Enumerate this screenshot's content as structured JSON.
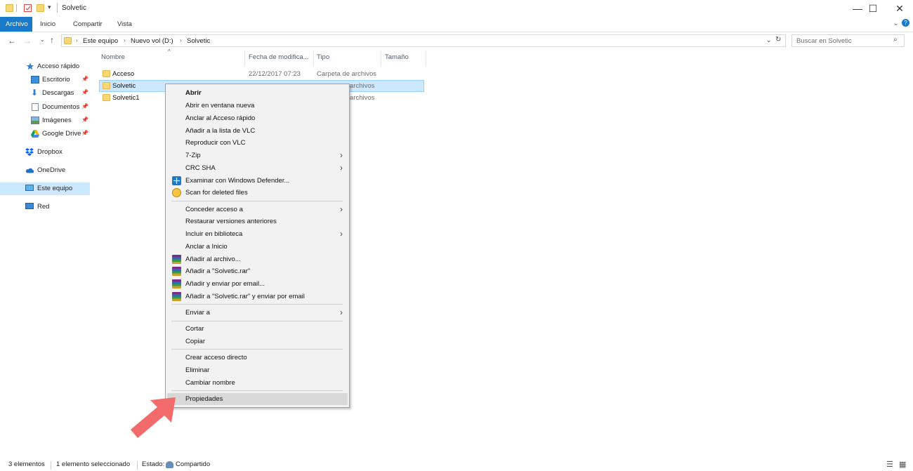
{
  "window": {
    "title": "Solvetic",
    "controls": [
      "minimize-icon",
      "maximize-icon",
      "close-icon"
    ]
  },
  "ribbon": {
    "tabs": [
      {
        "label": "Archivo",
        "active": true
      },
      {
        "label": "Inicio"
      },
      {
        "label": "Compartir"
      },
      {
        "label": "Vista"
      }
    ]
  },
  "address": {
    "breadcrumbs": [
      "Este equipo",
      "Nuevo vol (D:)",
      "Solvetic"
    ],
    "search_placeholder": "Buscar en Solvetic"
  },
  "nav": {
    "quick_access": "Acceso rápido",
    "items": [
      {
        "label": "Escritorio",
        "icon": "desktop-icon",
        "pinned": true
      },
      {
        "label": "Descargas",
        "icon": "download-icon",
        "pinned": true
      },
      {
        "label": "Documentos",
        "icon": "documents-icon",
        "pinned": true
      },
      {
        "label": "Imágenes",
        "icon": "pictures-icon",
        "pinned": true
      },
      {
        "label": "Google Drive",
        "icon": "google-drive-icon",
        "pinned": true
      }
    ],
    "dropbox": "Dropbox",
    "onedrive": "OneDrive",
    "this_pc": "Este equipo",
    "network": "Red"
  },
  "list": {
    "columns": [
      "Nombre",
      "Fecha de modifica...",
      "Tipo",
      "Tamaño"
    ],
    "rows": [
      {
        "name": "Acceso",
        "date": "22/12/2017 07:23",
        "type": "Carpeta de archivos"
      },
      {
        "name": "Solvetic",
        "type_visible": "archivos",
        "selected": true
      },
      {
        "name": "Solvetic1",
        "type_visible": "archivos"
      }
    ]
  },
  "context_menu": {
    "items": [
      "Abrir",
      "Abrir en ventana nueva",
      "Anclar al Acceso rápido",
      "Añadir a la lista de VLC",
      "Reproducir con VLC",
      "7-Zip",
      "CRC SHA",
      "Examinar con Windows Defender...",
      "Scan for deleted files",
      "Conceder acceso a",
      "Restaurar versiones anteriores",
      "Incluir en biblioteca",
      "Anclar a Inicio",
      "Añadir al archivo...",
      "Añadir a \"Solvetic.rar\"",
      "Añadir y enviar por email...",
      "Añadir a \"Solvetic.rar\" y enviar por email",
      "Enviar a",
      "Cortar",
      "Copiar",
      "Crear acceso directo",
      "Eliminar",
      "Cambiar nombre",
      "Propiedades"
    ]
  },
  "status": {
    "count": "3 elementos",
    "selected": "1 elemento seleccionado",
    "state_label": "Estado:",
    "state_value": "Compartido"
  },
  "colors": {
    "accent": "#1979ca",
    "selection": "#cce8ff",
    "arrow": "#f26a6a"
  }
}
